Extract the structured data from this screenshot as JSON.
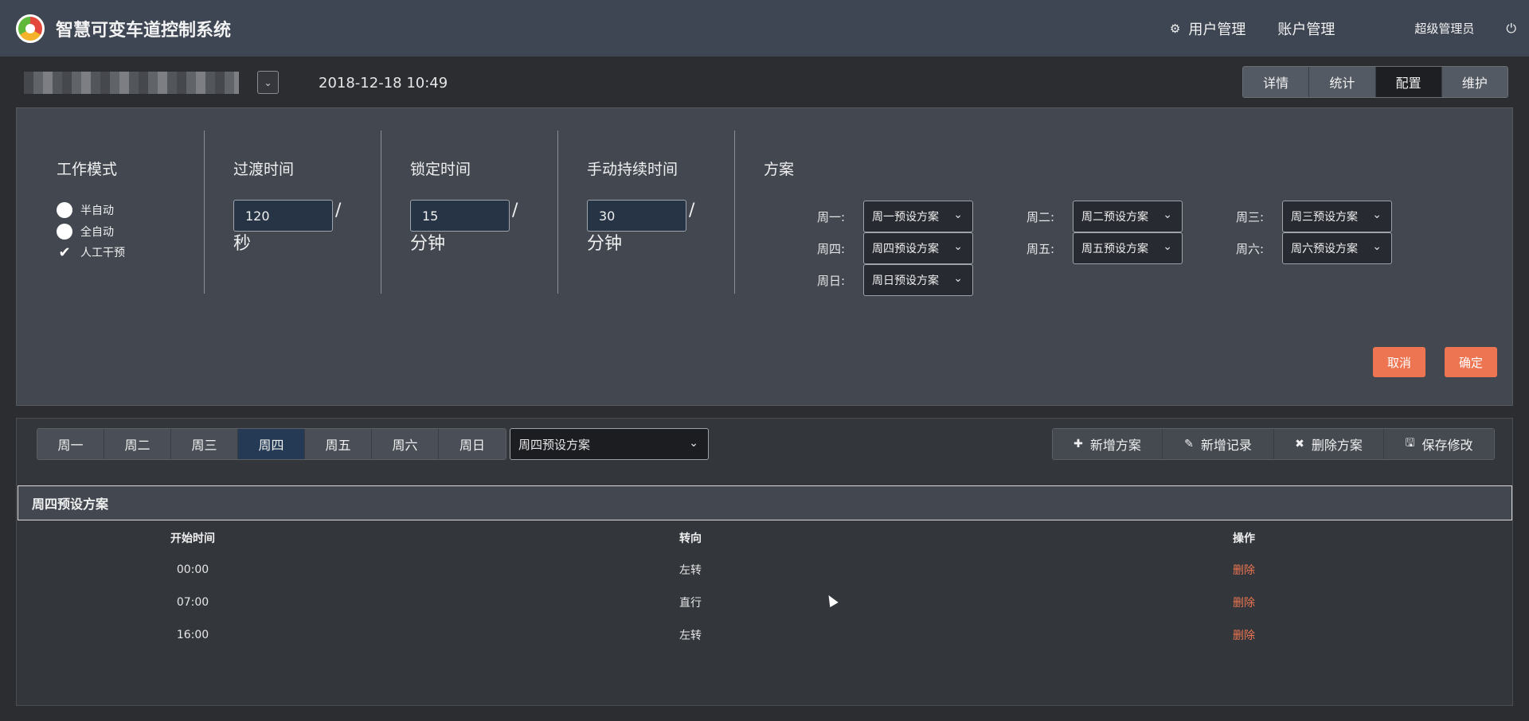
{
  "header": {
    "app_title": "智慧可变车道控制系统",
    "nav_user_mgmt": "用户管理",
    "nav_account_mgmt": "账户管理",
    "user": "超级管理员"
  },
  "toolbar": {
    "datetime": "2018-12-18 10:49",
    "tabs": [
      "详情",
      "统计",
      "配置",
      "维护"
    ],
    "active_tab": "配置"
  },
  "config": {
    "work_mode_title": "工作模式",
    "modes": [
      {
        "label": "半自动",
        "checked": false
      },
      {
        "label": "全自动",
        "checked": false
      },
      {
        "label": "人工干预",
        "checked": true
      }
    ],
    "transition": {
      "title": "过渡时间",
      "value": "120",
      "slash": "/",
      "unit": "秒"
    },
    "lock": {
      "title": "锁定时间",
      "value": "15",
      "slash": "/",
      "unit": "分钟"
    },
    "manual": {
      "title": "手动持续时间",
      "value": "30",
      "slash": "/",
      "unit": "分钟"
    },
    "plan_title": "方案",
    "days": [
      {
        "label": "周一:",
        "plan": "周一预设方案"
      },
      {
        "label": "周二:",
        "plan": "周二预设方案"
      },
      {
        "label": "周三:",
        "plan": "周三预设方案"
      },
      {
        "label": "周四:",
        "plan": "周四预设方案"
      },
      {
        "label": "周五:",
        "plan": "周五预设方案"
      },
      {
        "label": "周六:",
        "plan": "周六预设方案"
      },
      {
        "label": "周日:",
        "plan": "周日预设方案"
      }
    ],
    "cancel_label": "取消",
    "confirm_label": "确定"
  },
  "plans": {
    "week_tabs": [
      "周一",
      "周二",
      "周三",
      "周四",
      "周五",
      "周六",
      "周日"
    ],
    "active_week": "周四",
    "selected_plan": "周四预设方案",
    "actions": [
      "新增方案",
      "新增记录",
      "删除方案",
      "保存修改"
    ],
    "panel_title": "周四预设方案",
    "columns": [
      "开始时间",
      "转向",
      "操作"
    ],
    "rows": [
      {
        "time": "00:00",
        "direction": "左转",
        "action": "删除"
      },
      {
        "time": "07:00",
        "direction": "直行",
        "action": "删除"
      },
      {
        "time": "16:00",
        "direction": "左转",
        "action": "删除"
      }
    ]
  },
  "colors": {
    "accent": "#ee7551",
    "header_bg": "#3e4653",
    "active_tab": "#243a55"
  }
}
